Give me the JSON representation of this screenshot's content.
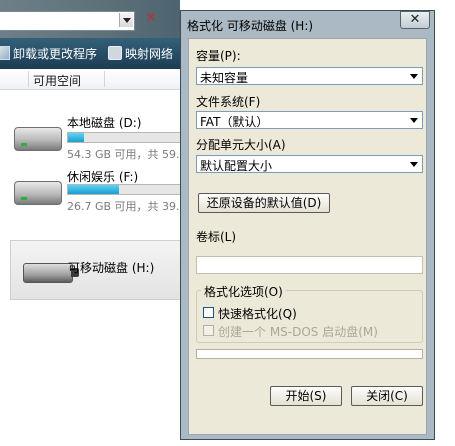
{
  "explorer": {
    "toolbar": {
      "uninstall_label": "卸载或更改程序",
      "map_label": "映射网络"
    },
    "column_header": "可用空间",
    "drives": [
      {
        "name": "本地磁盘 (D:)",
        "info": "54.3 GB 可用，共 59.",
        "used_fraction": 0.14
      },
      {
        "name": "休闲娱乐 (F:)",
        "info": "26.7 GB 可用，共 39.",
        "used_fraction": 0.45
      }
    ],
    "removable": {
      "name": "可移动磁盘 (H:)"
    }
  },
  "dialog": {
    "title": "格式化 可移动磁盘 (H:)",
    "close_glyph": "✕",
    "capacity": {
      "label": "容量(P):",
      "value": "未知容量"
    },
    "filesystem": {
      "label": "文件系统(F)",
      "value": "FAT（默认）"
    },
    "allocation": {
      "label": "分配单元大小(A)",
      "value": "默认配置大小"
    },
    "restore_button": "还原设备的默认值(D)",
    "volume_label": {
      "label": "卷标(L)",
      "value": ""
    },
    "options": {
      "title": "格式化选项(O)",
      "quick_format": {
        "label": "快速格式化(Q)",
        "checked": false
      },
      "msdos_boot": {
        "label": "创建一个 MS-DOS 启动盘(M)",
        "checked": false,
        "disabled": true
      }
    },
    "progress": 0,
    "start_button": "开始(S)",
    "close_button": "关闭(C)"
  }
}
